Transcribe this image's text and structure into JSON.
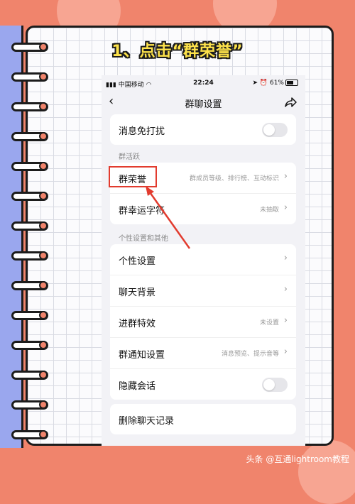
{
  "overlay": {
    "step_title": "1、点击“群荣誉”",
    "watermark": "头条 @互通lightroom教程"
  },
  "status_bar": {
    "carrier": "中国移动",
    "time": "22:24",
    "battery": "61%"
  },
  "nav": {
    "back_icon": "chevron-left-icon",
    "title": "群聊设置",
    "share_icon": "share-icon"
  },
  "settings": {
    "mute": {
      "label": "消息免打扰",
      "toggle_on": false
    },
    "section_active": "群活跃",
    "honor": {
      "label": "群荣誉",
      "hint": "群成员等级、排行榜、互动标识"
    },
    "lucky_char": {
      "label": "群幸运字符",
      "hint": "未抽取"
    },
    "section_personal": "个性设置和其他",
    "personal": {
      "label": "个性设置"
    },
    "chat_bg": {
      "label": "聊天背景"
    },
    "join_effect": {
      "label": "进群特效",
      "hint": "未设置"
    },
    "notify": {
      "label": "群通知设置",
      "hint": "消息预览、提示音等"
    },
    "hide_chat": {
      "label": "隐藏会话",
      "toggle_on": false
    },
    "delete_history": {
      "label": "删除聊天记录"
    }
  },
  "colors": {
    "background": "#f0846c",
    "title_yellow": "#fde24a",
    "highlight_red": "#e23b2e",
    "strip_blue": "#9aa7ee"
  }
}
